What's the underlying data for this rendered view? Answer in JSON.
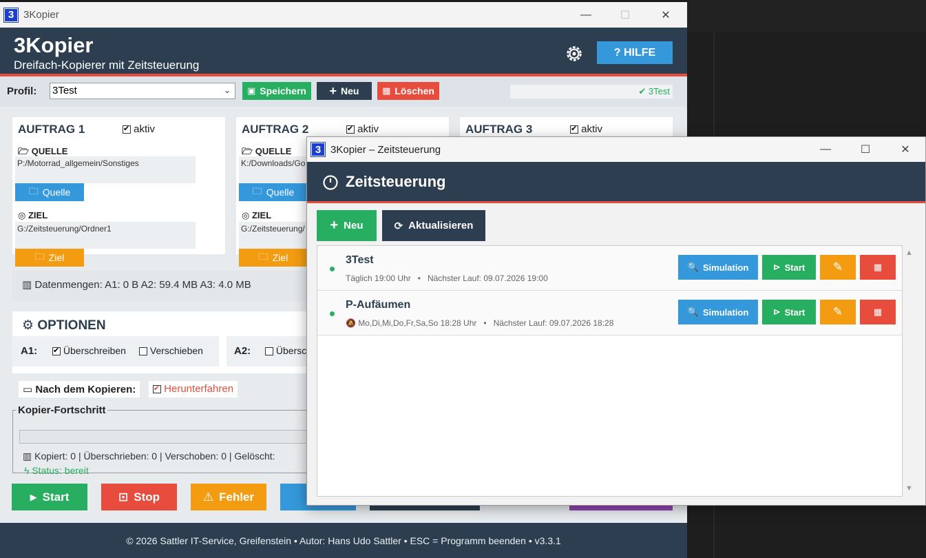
{
  "main": {
    "window_title": "3Kopier",
    "app_icon": "3",
    "app_name": "3Kopier",
    "subtitle": "Dreifach-Kopierer mit Zeitsteuerung",
    "help_label": "? HILFE",
    "profile": {
      "label": "Profil:",
      "selected": "3Test",
      "save_label": "Speichern",
      "new_label": "Neu",
      "delete_label": "Löschen",
      "status": "✔ 3Test"
    },
    "jobs": [
      {
        "title": "AUFTRAG 1",
        "active_label": "aktiv",
        "source_label": "QUELLE",
        "source_path": "P:/Motorrad_allgemein/Sonstiges",
        "source_btn": "Quelle",
        "target_label": "ZIEL",
        "target_path": "G:/Zeitsteuerung/Ordner1",
        "target_btn": "Ziel"
      },
      {
        "title": "AUFTRAG 2",
        "active_label": "aktiv",
        "source_label": "QUELLE",
        "source_path": "K:/Downloads/Go",
        "source_btn": "Quelle",
        "target_label": "ZIEL",
        "target_path": "G:/Zeitsteuerung/",
        "target_btn": "Ziel"
      },
      {
        "title": "AUFTRAG 3",
        "active_label": "aktiv"
      }
    ],
    "data_sizes": "Datenmengen: A1: 0 B  A2: 59.4 MB  A3: 4.0 MB",
    "options": {
      "title": "OPTIONEN",
      "a1_label": "A1:",
      "a1_overwrite": "Überschreiben",
      "a1_move": "Verschieben",
      "a2_label": "A2:",
      "a2_overwrite": "Übersc"
    },
    "after_copy_label": "Nach dem Kopieren:",
    "shutdown_label": "Herunterfahren",
    "progress": {
      "legend": "Kopier-Fortschritt",
      "value": 0,
      "counts": "Kopiert: 0  |  Überschrieben: 0  |  Verschoben: 0  |  Gelöscht:",
      "status": "Status: bereit"
    },
    "actions": {
      "start": "Start",
      "stop": "Stop",
      "errors": "Fehler"
    },
    "footer": "© 2026 Sattler IT-Service, Greifenstein  •  Autor: Hans Udo Sattler  •  ESC = Programm beenden  •  v3.3.1",
    "colors": {
      "header": "#2c3e50",
      "accent_red": "#e74c3c",
      "blue": "#3498db",
      "green": "#27ae60",
      "orange": "#f39c12",
      "purple": "#8e44ad"
    }
  },
  "dialog": {
    "window_title": "3Kopier – Zeitsteuerung",
    "heading": "Zeitsteuerung",
    "new_label": "Neu",
    "refresh_label": "Aktualisieren",
    "schedules": [
      {
        "name": "3Test",
        "schedule": "Täglich 19:00 Uhr",
        "sep": "•",
        "next": "Nächster Lauf: 09.07.2026 19:00"
      },
      {
        "name": "P-Aufäumen",
        "schedule": "Mo,Di,Mi,Do,Fr,Sa,So 18:28 Uhr",
        "sep": "•",
        "next": "Nächster Lauf: 09.07.2026 18:28"
      }
    ],
    "simulation_label": "Simulation",
    "start_label": "Start"
  }
}
